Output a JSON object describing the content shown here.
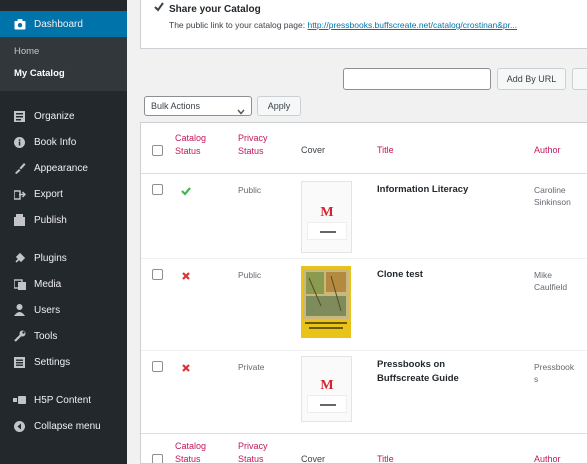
{
  "sidebar": {
    "dashboard": "Dashboard",
    "submenu": [
      "Home",
      "My Catalog"
    ],
    "items": [
      {
        "label": "Organize",
        "icon": "organize-icon"
      },
      {
        "label": "Book Info",
        "icon": "book-info-icon"
      },
      {
        "label": "Appearance",
        "icon": "appearance-icon"
      },
      {
        "label": "Export",
        "icon": "export-icon"
      },
      {
        "label": "Publish",
        "icon": "publish-icon"
      },
      {
        "label": "Plugins",
        "icon": "plugins-icon"
      },
      {
        "label": "Media",
        "icon": "media-icon"
      },
      {
        "label": "Users",
        "icon": "users-icon"
      },
      {
        "label": "Tools",
        "icon": "tools-icon"
      },
      {
        "label": "Settings",
        "icon": "settings-icon"
      },
      {
        "label": "H5P Content",
        "icon": "h5p-icon"
      },
      {
        "label": "Collapse menu",
        "icon": "collapse-icon"
      }
    ]
  },
  "share": {
    "title": "Share your Catalog",
    "description": "The public link to your catalog page:",
    "link": "http://pressbooks.buffscreate.net/catalog/crostinan&pr..."
  },
  "search": {
    "placeholder": "",
    "add_by_url": "Add By URL"
  },
  "bulk": {
    "selected": "Bulk Actions",
    "apply": "Apply"
  },
  "table": {
    "headers": {
      "catalog_status": [
        "Catalog",
        "Status"
      ],
      "privacy_status": [
        "Privacy",
        "Status"
      ],
      "cover": "Cover",
      "title": "Title",
      "author": "Author"
    },
    "rows": [
      {
        "catalog": "check",
        "privacy": "Public",
        "title": "Information Literacy",
        "author": [
          "Caroline",
          "Sinkinson"
        ],
        "cover": "default"
      },
      {
        "catalog": "x",
        "privacy": "Public",
        "title": "Clone test",
        "author": [
          "Mike",
          "Caulfield"
        ],
        "cover": "image"
      },
      {
        "catalog": "x",
        "privacy": "Private",
        "title_lines": [
          "Pressbooks on",
          "Buffscreate Guide"
        ],
        "author": [
          "Pressbook",
          "s"
        ],
        "cover": "default"
      }
    ]
  },
  "colors": {
    "sidebar_bg": "#23282d",
    "accent": "#0073aa",
    "sort_header": "#c2185b",
    "check_green": "#46b450",
    "x_red": "#dc3232",
    "pressbooks_red": "#d4242f"
  }
}
